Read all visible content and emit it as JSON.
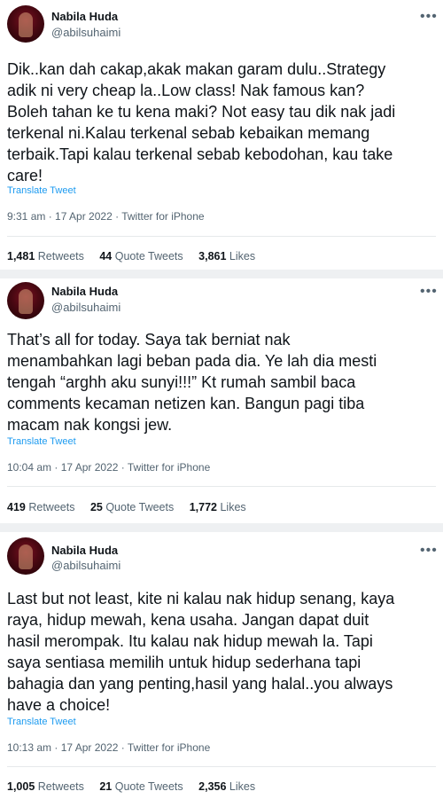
{
  "tweets": [
    {
      "name": "Nabila Huda",
      "handle": "@abilsuhaimi",
      "more": "•••",
      "lines": [
        "Dik..kan dah cakap,akak makan garam dulu..Strategy",
        "adik ni very cheap la..Low class! Nak famous kan?",
        "Boleh tahan ke tu kena maki? Not easy tau dik nak jadi",
        "terkenal ni.Kalau terkenal sebab kebaikan memang",
        "terbaik.Tapi kalau terkenal sebab kebodohan, kau take",
        "care!"
      ],
      "translate": "Translate Tweet",
      "meta": "9:31 am · 17 Apr 2022 · Twitter for iPhone",
      "retweets": "1,481",
      "retweets_label": "Retweets",
      "quotes": "44",
      "quotes_label": "Quote Tweets",
      "likes": "3,861",
      "likes_label": "Likes"
    },
    {
      "name": "Nabila Huda",
      "handle": "@abilsuhaimi",
      "more": "•••",
      "lines": [
        "That’s all for today. Saya tak berniat nak",
        "menambahkan lagi beban pada dia. Ye lah dia mesti",
        "tengah “arghh aku sunyi!!!” Kt rumah sambil baca",
        "comments kecaman netizen kan. Bangun pagi tiba",
        "macam nak kongsi jew."
      ],
      "translate": "Translate Tweet",
      "meta": "10:04 am · 17 Apr 2022 · Twitter for iPhone",
      "retweets": "419",
      "retweets_label": "Retweets",
      "quotes": "25",
      "quotes_label": "Quote Tweets",
      "likes": "1,772",
      "likes_label": "Likes"
    },
    {
      "name": "Nabila Huda",
      "handle": "@abilsuhaimi",
      "more": "•••",
      "lines": [
        "Last but not least, kite ni kalau nak hidup senang, kaya",
        "raya, hidup mewah, kena usaha. Jangan dapat duit",
        "hasil merompak. Itu kalau nak hidup mewah la. Tapi",
        "saya sentiasa memilih untuk hidup sederhana tapi",
        "bahagia dan yang penting,hasil yang halal..you always",
        "have a choice!"
      ],
      "translate": "Translate Tweet",
      "meta": "10:13 am · 17 Apr 2022 · Twitter for iPhone",
      "retweets": "1,005",
      "retweets_label": "Retweets",
      "quotes": "21",
      "quotes_label": "Quote Tweets",
      "likes": "2,356",
      "likes_label": "Likes"
    }
  ]
}
